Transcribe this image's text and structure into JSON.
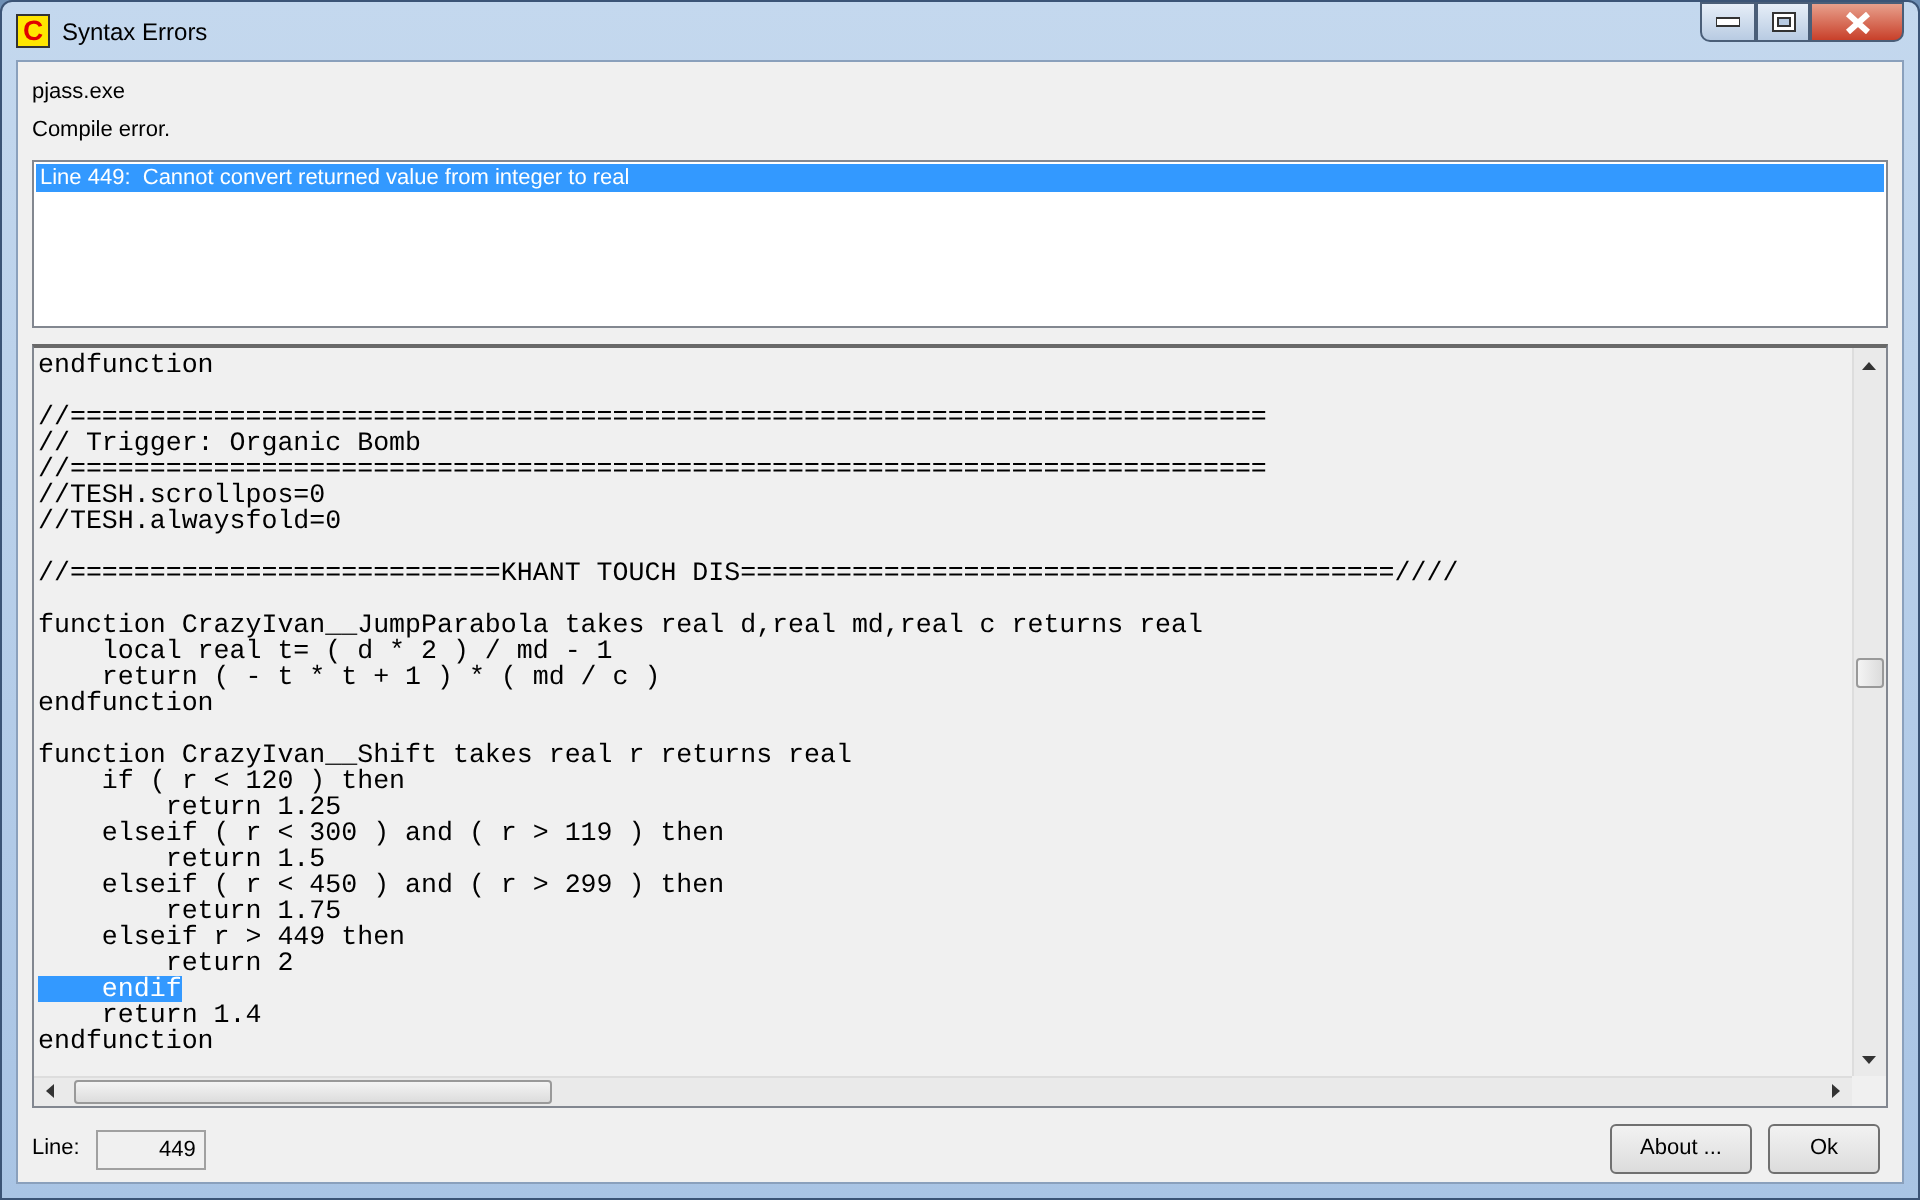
{
  "window": {
    "title": "Syntax Errors",
    "icon_letter": "C"
  },
  "program": "pjass.exe",
  "message": "Compile error.",
  "errors": [
    {
      "text": "Line 449:  Cannot convert returned value from integer to real",
      "selected": true
    }
  ],
  "code_lines": [
    {
      "kind": "code",
      "text": "endfunction",
      "selected": false
    },
    {
      "kind": "blank"
    },
    {
      "kind": "code",
      "text": "//===========================================================================",
      "selected": false
    },
    {
      "kind": "code",
      "text": "// Trigger: Organic Bomb",
      "selected": false
    },
    {
      "kind": "code",
      "text": "//===========================================================================",
      "selected": false
    },
    {
      "kind": "code",
      "text": "//TESH.scrollpos=0",
      "selected": false
    },
    {
      "kind": "code",
      "text": "//TESH.alwaysfold=0",
      "selected": false
    },
    {
      "kind": "blank"
    },
    {
      "kind": "code",
      "text": "//===========================KHANT TOUCH DIS=========================================////",
      "selected": false
    },
    {
      "kind": "blank"
    },
    {
      "kind": "code",
      "text": "function CrazyIvan__JumpParabola takes real d,real md,real c returns real",
      "selected": false
    },
    {
      "kind": "code",
      "text": "    local real t= ( d * 2 ) / md - 1",
      "selected": false
    },
    {
      "kind": "code",
      "text": "    return ( - t * t + 1 ) * ( md / c )",
      "selected": false
    },
    {
      "kind": "code",
      "text": "endfunction",
      "selected": false
    },
    {
      "kind": "blank"
    },
    {
      "kind": "code",
      "text": "function CrazyIvan__Shift takes real r returns real",
      "selected": false
    },
    {
      "kind": "code",
      "text": "    if ( r < 120 ) then",
      "selected": false
    },
    {
      "kind": "code",
      "text": "        return 1.25",
      "selected": false
    },
    {
      "kind": "code",
      "text": "    elseif ( r < 300 ) and ( r > 119 ) then",
      "selected": false
    },
    {
      "kind": "code",
      "text": "        return 1.5",
      "selected": false
    },
    {
      "kind": "code",
      "text": "    elseif ( r < 450 ) and ( r > 299 ) then",
      "selected": false
    },
    {
      "kind": "code",
      "text": "        return 1.75",
      "selected": false
    },
    {
      "kind": "code",
      "text": "    elseif r > 449 then",
      "selected": false
    },
    {
      "kind": "code",
      "text": "        return 2",
      "selected": false
    },
    {
      "kind": "code",
      "text": "    endif",
      "selected": true
    },
    {
      "kind": "code",
      "text": "    return 1.4",
      "selected": false
    },
    {
      "kind": "code",
      "text": "endfunction",
      "selected": false
    }
  ],
  "line_field": {
    "label": "Line:",
    "value": "449"
  },
  "buttons": [
    "About ...",
    "Ok"
  ]
}
